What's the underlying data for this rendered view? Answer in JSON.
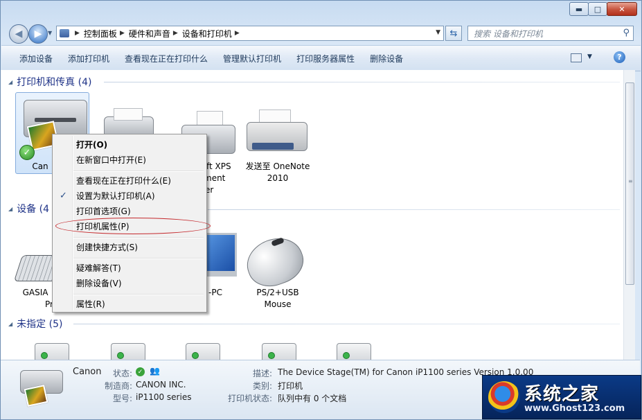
{
  "window": {
    "min_label": "▬",
    "max_label": "□",
    "close_label": "✕"
  },
  "address": {
    "crumbs": [
      "控制面板",
      "硬件和声音",
      "设备和打印机"
    ],
    "search_placeholder": "搜索 设备和打印机"
  },
  "toolbar": {
    "commands": [
      "添加设备",
      "添加打印机",
      "查看现在正在打印什么",
      "管理默认打印机",
      "打印服务器属性",
      "删除设备"
    ],
    "help_label": "?"
  },
  "groups": {
    "printers": {
      "title": "打印机和传真 (4)"
    },
    "devices": {
      "title": "设备 (4"
    },
    "unspecified": {
      "title": "未指定 (5)"
    }
  },
  "printers": {
    "items": [
      {
        "label": "Can"
      },
      {
        "label": "ft XPS"
      },
      {
        "label": "ment"
      },
      {
        "label": "er"
      },
      {
        "label": "发送至 OneNote"
      },
      {
        "label": "2010"
      }
    ]
  },
  "devices": {
    "items": [
      {
        "label": "GASIA"
      },
      {
        "label": "Pr"
      },
      {
        "label": "-PC"
      },
      {
        "label": "PS/2+USB"
      },
      {
        "label": "Mouse"
      }
    ]
  },
  "context_menu": {
    "items": [
      "打开(O)",
      "在新窗口中打开(E)",
      "查看现在正在打印什么(E)",
      "设置为默认打印机(A)",
      "打印首选项(G)",
      "打印机属性(P)",
      "创建快捷方式(S)",
      "疑难解答(T)",
      "删除设备(V)",
      "属性(R)"
    ],
    "checked": "设置为默认打印机(A)",
    "highlighted": "打印机属性(P)"
  },
  "details": {
    "name": "Canon",
    "status_label": "状态:",
    "manufacturer_label": "制造商:",
    "manufacturer": "CANON INC.",
    "model_label": "型号:",
    "model": "iP1100 series",
    "description_label": "描述:",
    "description": "The Device Stage(TM) for Canon iP1100 series Version 1.0.00",
    "category_label": "类别:",
    "category": "打印机",
    "printer_status_label": "打印机状态:",
    "printer_status": "队列中有 0 个文档"
  },
  "watermark": {
    "title": "系统之家",
    "url": "www.Ghost123.com"
  },
  "colors": {
    "group_header": "#1e3287",
    "menu_ring": "#c4282c",
    "selection": "#cfe3f9"
  }
}
